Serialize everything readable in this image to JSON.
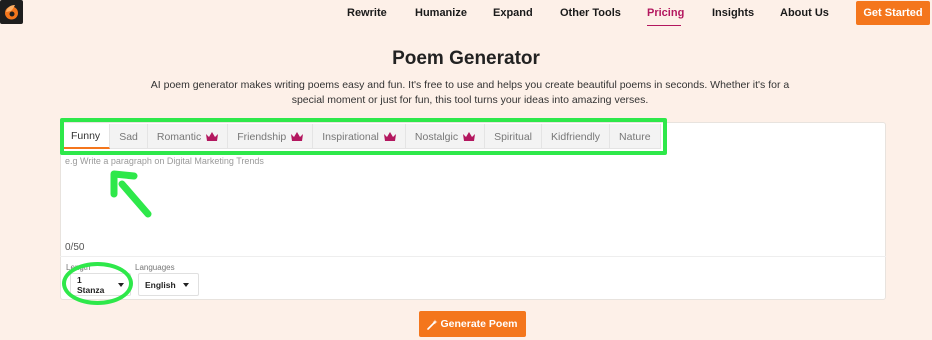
{
  "nav": {
    "items": [
      {
        "label": "Rewrite",
        "active": false
      },
      {
        "label": "Humanize",
        "active": false
      },
      {
        "label": "Expand",
        "active": false
      },
      {
        "label": "Other Tools",
        "active": false
      },
      {
        "label": "Pricing",
        "active": true
      },
      {
        "label": "Insights",
        "active": false
      },
      {
        "label": "About Us",
        "active": false
      }
    ],
    "cta_label": "Get Started"
  },
  "hero": {
    "title": "Poem Generator",
    "subtitle": "AI poem generator makes writing poems easy and fun. It's free to use and helps you create beautiful poems in seconds. Whether it's for a special moment or just for fun, this tool turns your ideas into amazing verses."
  },
  "tabs": [
    {
      "label": "Funny",
      "premium": false,
      "active": true
    },
    {
      "label": "Sad",
      "premium": false,
      "active": false
    },
    {
      "label": "Romantic",
      "premium": true,
      "active": false
    },
    {
      "label": "Friendship",
      "premium": true,
      "active": false
    },
    {
      "label": "Inspirational",
      "premium": true,
      "active": false
    },
    {
      "label": "Nostalgic",
      "premium": true,
      "active": false
    },
    {
      "label": "Spiritual",
      "premium": false,
      "active": false
    },
    {
      "label": "Kidfriendly",
      "premium": false,
      "active": false
    },
    {
      "label": "Nature",
      "premium": false,
      "active": false
    }
  ],
  "editor": {
    "placeholder": "e.g Write a paragraph on Digital Marketing Trends",
    "value": "",
    "counter": "0/50"
  },
  "options": {
    "length_label": "Length",
    "length_value": "1 Stanza",
    "language_label": "Languages",
    "language_value": "English"
  },
  "generate_label": "Generate Poem",
  "colors": {
    "accent": "#f4761c",
    "active_nav": "#b3175f",
    "premium_crown": "#b3175f",
    "annotation": "#2ee84a",
    "background": "#fdf0e8"
  },
  "icons": {
    "crown": "crown-icon",
    "wand": "magic-wand-icon",
    "caret": "caret-down-icon"
  }
}
